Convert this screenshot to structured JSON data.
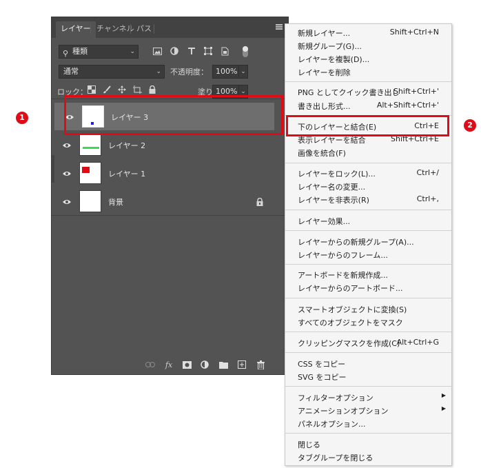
{
  "panel": {
    "tabs": [
      {
        "label": "レイヤー",
        "active": true
      },
      {
        "label": "チャンネル",
        "active": false
      },
      {
        "label": "パス",
        "active": false
      }
    ],
    "filter_kind": "種類",
    "filter_icons": [
      "image-filter-icon",
      "adjustment-filter-icon",
      "type-filter-icon",
      "shape-filter-icon",
      "smart-object-filter-icon"
    ],
    "blend_mode": "通常",
    "opacity_label": "不透明度：",
    "opacity_value": "100%",
    "lock_label": "ロック：",
    "fill_label": "塗り：",
    "fill_value": "100%",
    "layers": [
      {
        "name": "レイヤー 3",
        "selected": true,
        "visible": true,
        "thumb": "blue-dot"
      },
      {
        "name": "レイヤー 2",
        "selected": false,
        "visible": true,
        "thumb": "green-line"
      },
      {
        "name": "レイヤー 1",
        "selected": false,
        "visible": true,
        "thumb": "red-square"
      },
      {
        "name": "背景",
        "selected": false,
        "visible": true,
        "thumb": "white",
        "locked": true
      }
    ],
    "bottom_icons": [
      "link-icon",
      "fx-icon",
      "mask-icon",
      "adjustment-icon",
      "folder-icon",
      "new-layer-icon",
      "trash-icon"
    ],
    "fx_label": "fx"
  },
  "menu": {
    "groups": [
      [
        {
          "label": "新規レイヤー...",
          "shortcut": "Shift+Ctrl+N"
        },
        {
          "label": "新規グループ(G)...",
          "shortcut": ""
        },
        {
          "label": "レイヤーを複製(D)...",
          "shortcut": ""
        },
        {
          "label": "レイヤーを削除",
          "shortcut": ""
        }
      ],
      [
        {
          "label": "PNG としてクイック書き出し",
          "shortcut": "Shift+Ctrl+'"
        },
        {
          "label": "書き出し形式...",
          "shortcut": "Alt+Shift+Ctrl+'"
        }
      ],
      [
        {
          "label": "下のレイヤーと結合(E)",
          "shortcut": "Ctrl+E"
        },
        {
          "label": "表示レイヤーを結合",
          "shortcut": "Shift+Ctrl+E"
        },
        {
          "label": "画像を統合(F)",
          "shortcut": ""
        }
      ],
      [
        {
          "label": "レイヤーをロック(L)...",
          "shortcut": "Ctrl+/"
        },
        {
          "label": "レイヤー名の変更...",
          "shortcut": ""
        },
        {
          "label": "レイヤーを非表示(R)",
          "shortcut": "Ctrl+,"
        }
      ],
      [
        {
          "label": "レイヤー効果...",
          "shortcut": ""
        }
      ],
      [
        {
          "label": "レイヤーからの新規グループ(A)...",
          "shortcut": ""
        },
        {
          "label": "レイヤーからのフレーム...",
          "shortcut": ""
        }
      ],
      [
        {
          "label": "アートボードを新規作成...",
          "shortcut": ""
        },
        {
          "label": "レイヤーからのアートボード...",
          "shortcut": ""
        }
      ],
      [
        {
          "label": "スマートオブジェクトに変換(S)",
          "shortcut": ""
        },
        {
          "label": "すべてのオブジェクトをマスク",
          "shortcut": ""
        }
      ],
      [
        {
          "label": "クリッピングマスクを作成(C)",
          "shortcut": "Alt+Ctrl+G"
        }
      ],
      [
        {
          "label": "CSS をコピー",
          "shortcut": ""
        },
        {
          "label": "SVG をコピー",
          "shortcut": ""
        }
      ],
      [
        {
          "label": "フィルターオプション",
          "shortcut": "",
          "submenu": true
        },
        {
          "label": "アニメーションオプション",
          "shortcut": "",
          "submenu": true
        },
        {
          "label": "パネルオプション...",
          "shortcut": ""
        }
      ],
      [
        {
          "label": "閉じる",
          "shortcut": ""
        },
        {
          "label": "タブグループを閉じる",
          "shortcut": ""
        }
      ]
    ]
  },
  "annotations": {
    "badge1": "1",
    "badge2": "2",
    "highlight_color": "#e00b18"
  }
}
